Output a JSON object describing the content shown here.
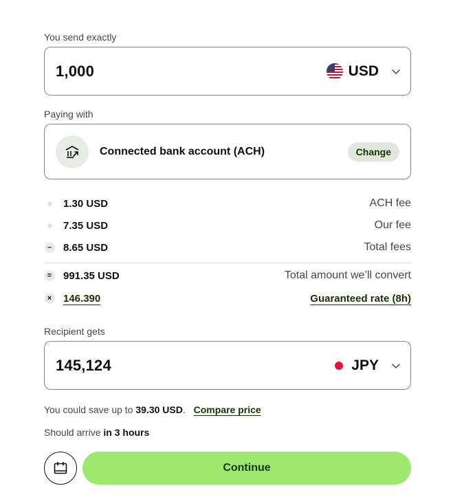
{
  "send": {
    "label": "You send exactly",
    "amount": "1,000",
    "currency": "USD"
  },
  "paying": {
    "label": "Paying with",
    "method": "Connected bank account (ACH)",
    "change_label": "Change"
  },
  "fees": {
    "ach_fee_value": "1.30 USD",
    "ach_fee_label": "ACH fee",
    "our_fee_value": "7.35 USD",
    "our_fee_label": "Our fee",
    "total_fees_value": "8.65 USD",
    "total_fees_label": "Total fees",
    "convert_value": "991.35 USD",
    "convert_label": "Total amount we’ll convert",
    "rate_value": "146.390",
    "rate_label": "Guaranteed rate (8h)",
    "minus_symbol": "–",
    "equals_symbol": "=",
    "times_symbol": "×"
  },
  "recipient": {
    "label": "Recipient gets",
    "amount": "145,124",
    "currency": "JPY"
  },
  "savings": {
    "prefix": "You could save up to",
    "amount": "39.30 USD",
    "suffix": ".",
    "compare_label": "Compare price"
  },
  "arrival": {
    "prefix": "Should arrive",
    "time": "in 3 hours"
  },
  "actions": {
    "continue_label": "Continue",
    "schedule_icon": "calendar-icon"
  },
  "colors": {
    "accent_green": "#9fe870",
    "forest_green": "#163300",
    "jpy_red": "#e6163e"
  }
}
